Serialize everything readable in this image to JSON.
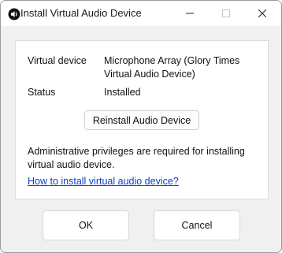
{
  "window": {
    "title": "Install Virtual Audio Device"
  },
  "titlebar": {
    "icons": [
      "speaker-icon",
      "minimize-icon",
      "maximize-icon",
      "close-icon"
    ]
  },
  "info": {
    "device_label": "Virtual device",
    "device_value_line1": "Microphone Array (Glory Times",
    "device_value_line2": "Virtual Audio Device)",
    "status_label": "Status",
    "status_value": "Installed"
  },
  "actions": {
    "reinstall_label": "Reinstall Audio Device"
  },
  "notice": {
    "text": "Administrative privileges are required for installing virtual audio device.",
    "link_text": "How to install virtual audio device?"
  },
  "footer": {
    "ok_label": "OK",
    "cancel_label": "Cancel"
  },
  "colors": {
    "link": "#0a40d6",
    "dialog_bg": "#f0f0f0",
    "panel_bg": "#ffffff"
  }
}
